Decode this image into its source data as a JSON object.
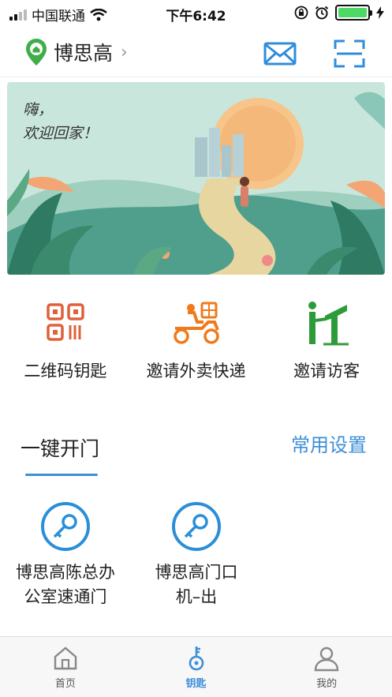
{
  "status_bar": {
    "carrier": "中国联通",
    "time": "下午6:42",
    "battery_color": "#4cd964"
  },
  "header": {
    "community_name": "博思高",
    "chevron": "›",
    "icons": [
      "location-home-icon",
      "mail-icon",
      "scan-icon"
    ]
  },
  "banner": {
    "line1": "嗨，",
    "line2": "欢迎回家！"
  },
  "actions": [
    {
      "label": "二维码钥匙",
      "icon": "qr-code-icon",
      "color": "#e0603a"
    },
    {
      "label": "邀请外卖快递",
      "icon": "delivery-scooter-icon",
      "color": "#f07a1a"
    },
    {
      "label": "邀请访客",
      "icon": "visitor-icon",
      "color": "#2e9b3a"
    }
  ],
  "section": {
    "title": "一键开门",
    "link": "常用设置",
    "accent": "#3d8fd6"
  },
  "doors": [
    {
      "label": "博思高陈总办公室速通门",
      "icon": "key-circle-icon"
    },
    {
      "label": "博思高门口机–出",
      "icon": "key-circle-icon"
    }
  ],
  "tabbar": [
    {
      "label": "首页",
      "icon": "home-icon",
      "active": false
    },
    {
      "label": "钥匙",
      "icon": "key-icon",
      "active": true
    },
    {
      "label": "我的",
      "icon": "person-icon",
      "active": false
    }
  ]
}
